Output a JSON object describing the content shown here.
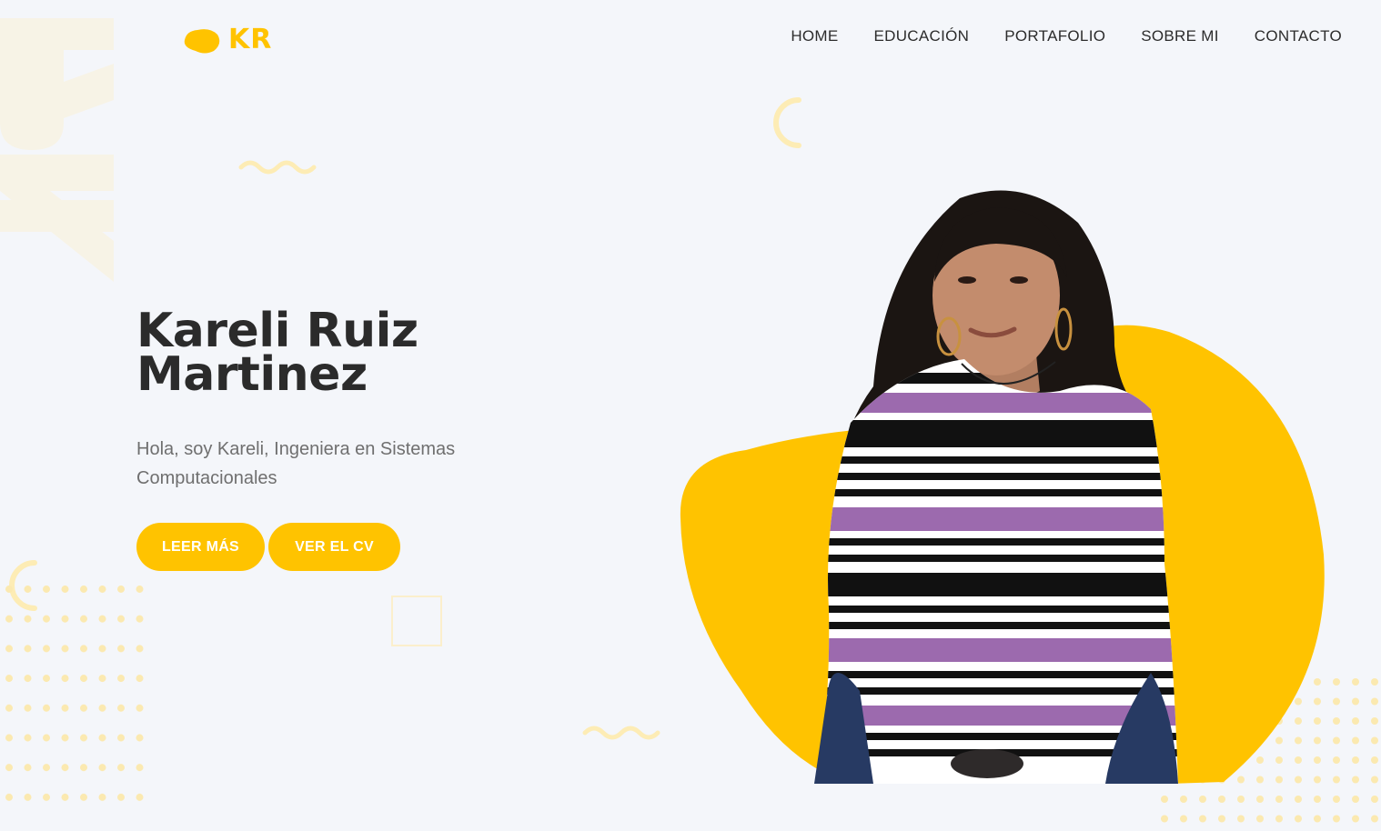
{
  "brand": {
    "logo_text": "KR",
    "watermark_text": "KR",
    "accent_color": "#ffc300"
  },
  "nav": {
    "items": [
      {
        "label": "HOME"
      },
      {
        "label": "EDUCACIÓN"
      },
      {
        "label": "PORTAFOLIO"
      },
      {
        "label": "SOBRE MI"
      },
      {
        "label": "CONTACTO"
      }
    ]
  },
  "hero": {
    "title_line1": "Kareli Ruiz",
    "title_line2": "Martinez",
    "subtitle": "Hola, soy Kareli, Ingeniera en Sistemas Computacionales",
    "buttons": {
      "read_more": "LEER MÁS",
      "view_cv": "VER EL CV"
    },
    "image_alt": "Portrait of Kareli Ruiz Martinez"
  }
}
